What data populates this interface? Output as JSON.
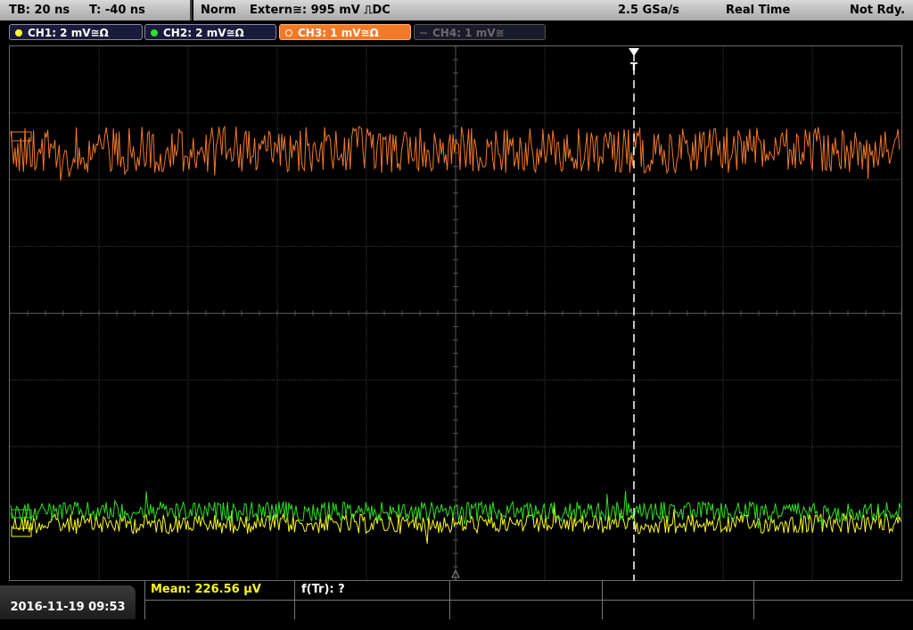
{
  "status_bar": {
    "timebase": "TB: 20 ns",
    "trigger_time": "T: -40 ns",
    "trigger_mode": "Norm",
    "trigger_source": "Extern≅: 995 mV ⎍DC",
    "sample_rate": "2.5 GSa/s",
    "acquisition_mode": "Real Time",
    "ready_state": "Not Rdy."
  },
  "channels": [
    {
      "label": "CH1: 2 mV≅Ω",
      "color": "#ffff30",
      "state": "on"
    },
    {
      "label": "CH2: 2 mV≅Ω",
      "color": "#30e030",
      "state": "on"
    },
    {
      "label": "CH3: 1 mV≅Ω",
      "color": "#f07a28",
      "state": "selected"
    },
    {
      "label": "CH4: 1 mV≅",
      "color": "#6a6a6a",
      "state": "off"
    }
  ],
  "trigger_marker": "T",
  "datetime": "2016-11-19 09:53",
  "measurements": {
    "mean": "Mean: 226.56 µV",
    "frequency": "f(Tr): ?"
  },
  "colors": {
    "ch1": "#f8f820",
    "ch2": "#30e020",
    "ch3": "#f07828",
    "grid": "#3a3a3a"
  }
}
